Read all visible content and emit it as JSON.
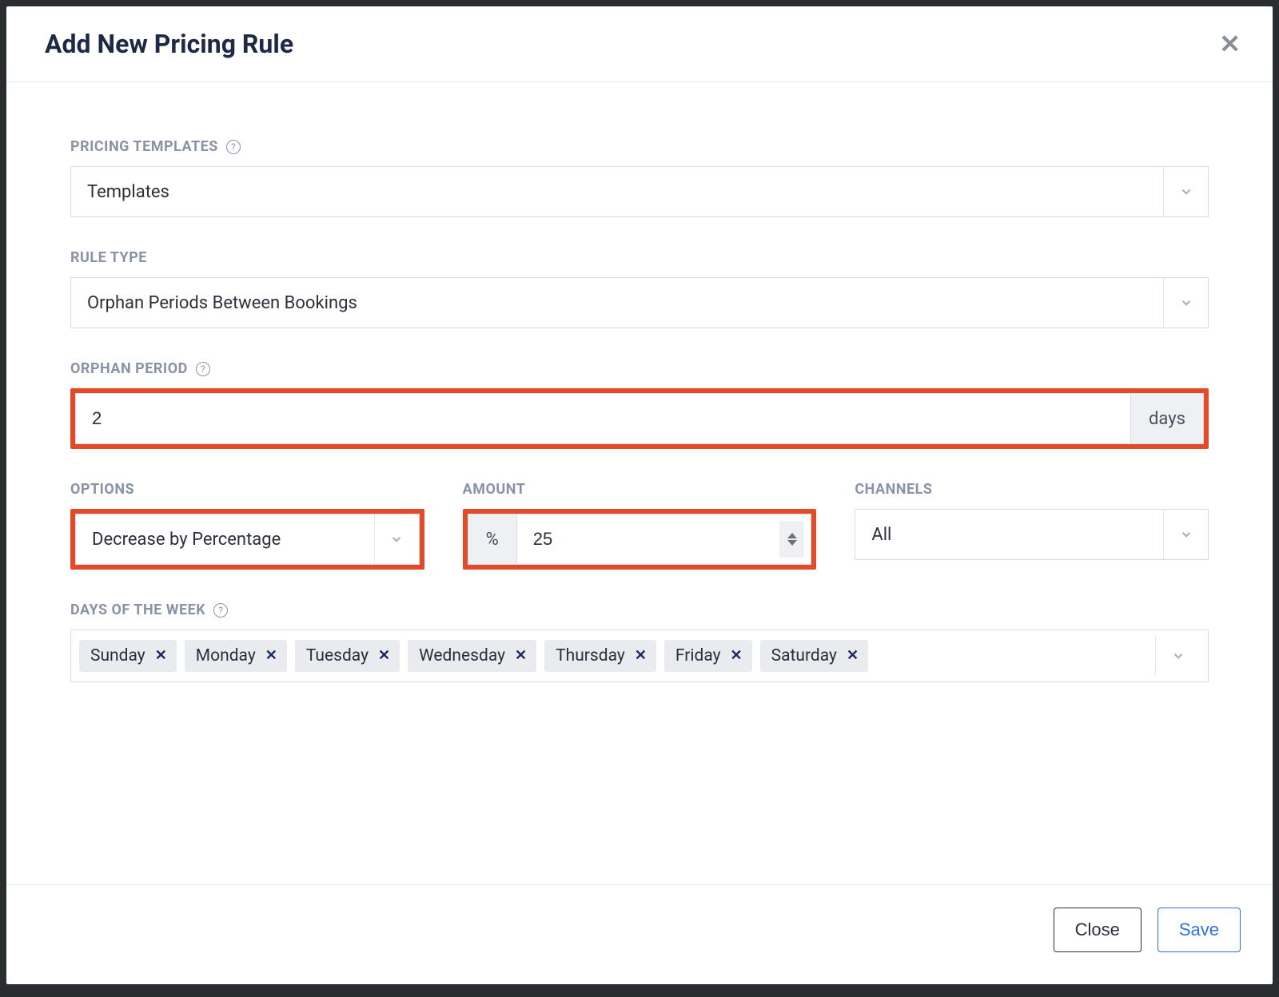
{
  "modal": {
    "title": "Add New Pricing Rule",
    "buttons": {
      "close": "Close",
      "save": "Save"
    }
  },
  "fields": {
    "templates": {
      "label": "PRICING TEMPLATES",
      "value": "Templates",
      "help": "?"
    },
    "rule_type": {
      "label": "RULE TYPE",
      "value": "Orphan Periods Between Bookings"
    },
    "orphan_period": {
      "label": "ORPHAN PERIOD",
      "help": "?",
      "value": "2",
      "unit": "days"
    },
    "options": {
      "label": "OPTIONS",
      "value": "Decrease by Percentage"
    },
    "amount": {
      "label": "AMOUNT",
      "prefix": "%",
      "value": "25"
    },
    "channels": {
      "label": "CHANNELS",
      "value": "All"
    },
    "days": {
      "label": "DAYS OF THE WEEK",
      "help": "?",
      "items": [
        "Sunday",
        "Monday",
        "Tuesday",
        "Wednesday",
        "Thursday",
        "Friday",
        "Saturday"
      ]
    }
  }
}
